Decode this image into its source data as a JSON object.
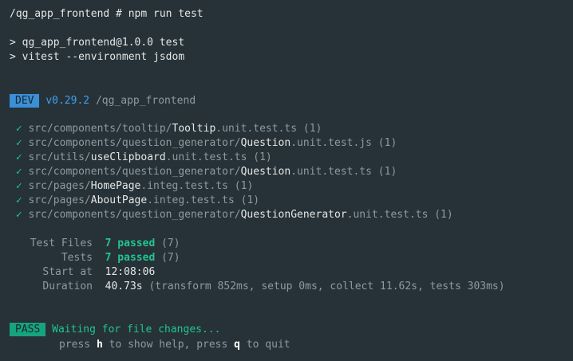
{
  "prompt": {
    "text": "/qg_app_frontend # npm run test"
  },
  "script_echo": [
    "> qg_app_frontend@1.0.0 test",
    "> vitest --environment jsdom"
  ],
  "header": {
    "mode_badge": "DEV",
    "version": "v0.29.2",
    "project_path": "/qg_app_frontend"
  },
  "check_glyph": "✓",
  "tests": [
    {
      "dir": "src/components/tooltip/",
      "name": "Tooltip",
      "suffix": ".unit.test.ts",
      "count": "(1)"
    },
    {
      "dir": "src/components/question_generator/",
      "name": "Question",
      "suffix": ".unit.test.js",
      "count": "(1)"
    },
    {
      "dir": "src/utils/",
      "name": "useClipboard",
      "suffix": ".unit.test.ts",
      "count": "(1)"
    },
    {
      "dir": "src/components/question_generator/",
      "name": "Question",
      "suffix": ".unit.test.ts",
      "count": "(1)"
    },
    {
      "dir": "src/pages/",
      "name": "HomePage",
      "suffix": ".integ.test.ts",
      "count": "(1)"
    },
    {
      "dir": "src/pages/",
      "name": "AboutPage",
      "suffix": ".integ.test.ts",
      "count": "(1)"
    },
    {
      "dir": "src/components/question_generator/",
      "name": "QuestionGenerator",
      "suffix": ".unit.test.ts",
      "count": "(1)"
    }
  ],
  "summary": {
    "test_files_label": "Test Files",
    "test_files_result": "7 passed",
    "test_files_count": "(7)",
    "tests_label": "Tests",
    "tests_result": "7 passed",
    "tests_count": "(7)",
    "start_label": "Start at",
    "start_value": "12:08:06",
    "duration_label": "Duration",
    "duration_value": "40.73s",
    "duration_detail": "(transform 852ms, setup 0ms, collect 11.62s, tests 303ms)"
  },
  "footer": {
    "status_badge": "PASS",
    "waiting_text": "Waiting for file changes...",
    "help_pre": "press ",
    "help_key": "h",
    "help_mid": " to show help, press ",
    "quit_key": "q",
    "help_post": " to quit"
  },
  "colors": {
    "background": "#263238",
    "text": "#e6e6e6",
    "dim": "#8f9aa0",
    "success": "#22c48f",
    "accent_blue": "#3ea3f0",
    "dev_badge": "#3a8fd7",
    "pass_badge": "#16a37f"
  }
}
